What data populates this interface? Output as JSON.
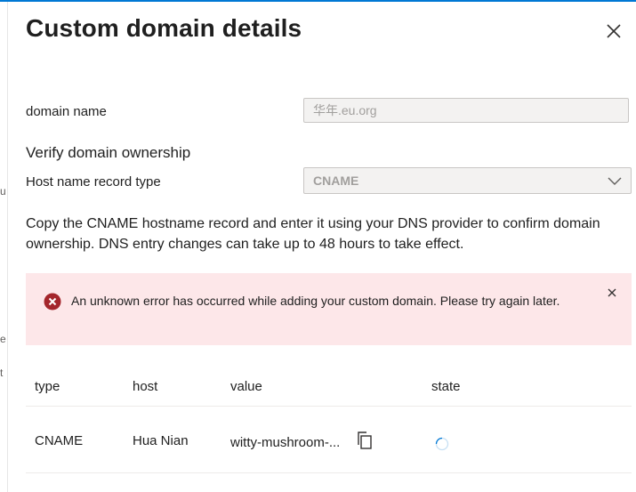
{
  "panel": {
    "title": "Custom domain details"
  },
  "form": {
    "domain_name_label": "domain name",
    "domain_name_value": "华年.eu.org",
    "verify_heading": "Verify domain ownership",
    "record_type_label": "Host name record type",
    "record_type_value": "CNAME"
  },
  "instructions": "Copy the CNAME hostname record and enter it using your DNS provider to confirm domain ownership. DNS entry changes can take up to 48 hours to take effect.",
  "error": {
    "message": "An unknown error has occurred while adding your custom domain. Please try again later."
  },
  "table": {
    "headers": [
      "type",
      "host",
      "value",
      "state"
    ],
    "rows": [
      {
        "type": "CNAME",
        "host": "Hua Nian",
        "value": "witty-mushroom-..."
      }
    ]
  },
  "left_edge_glyphs": [
    "u",
    "e",
    "t"
  ],
  "colors": {
    "accent": "#0078d4",
    "error_bg": "#fde7e9",
    "error_icon": "#a4262c"
  },
  "icons": {
    "close": "close-icon",
    "chevron": "chevron-down-icon",
    "error": "error-circle-icon",
    "copy": "copy-icon",
    "state": "loading-spinner-icon"
  }
}
